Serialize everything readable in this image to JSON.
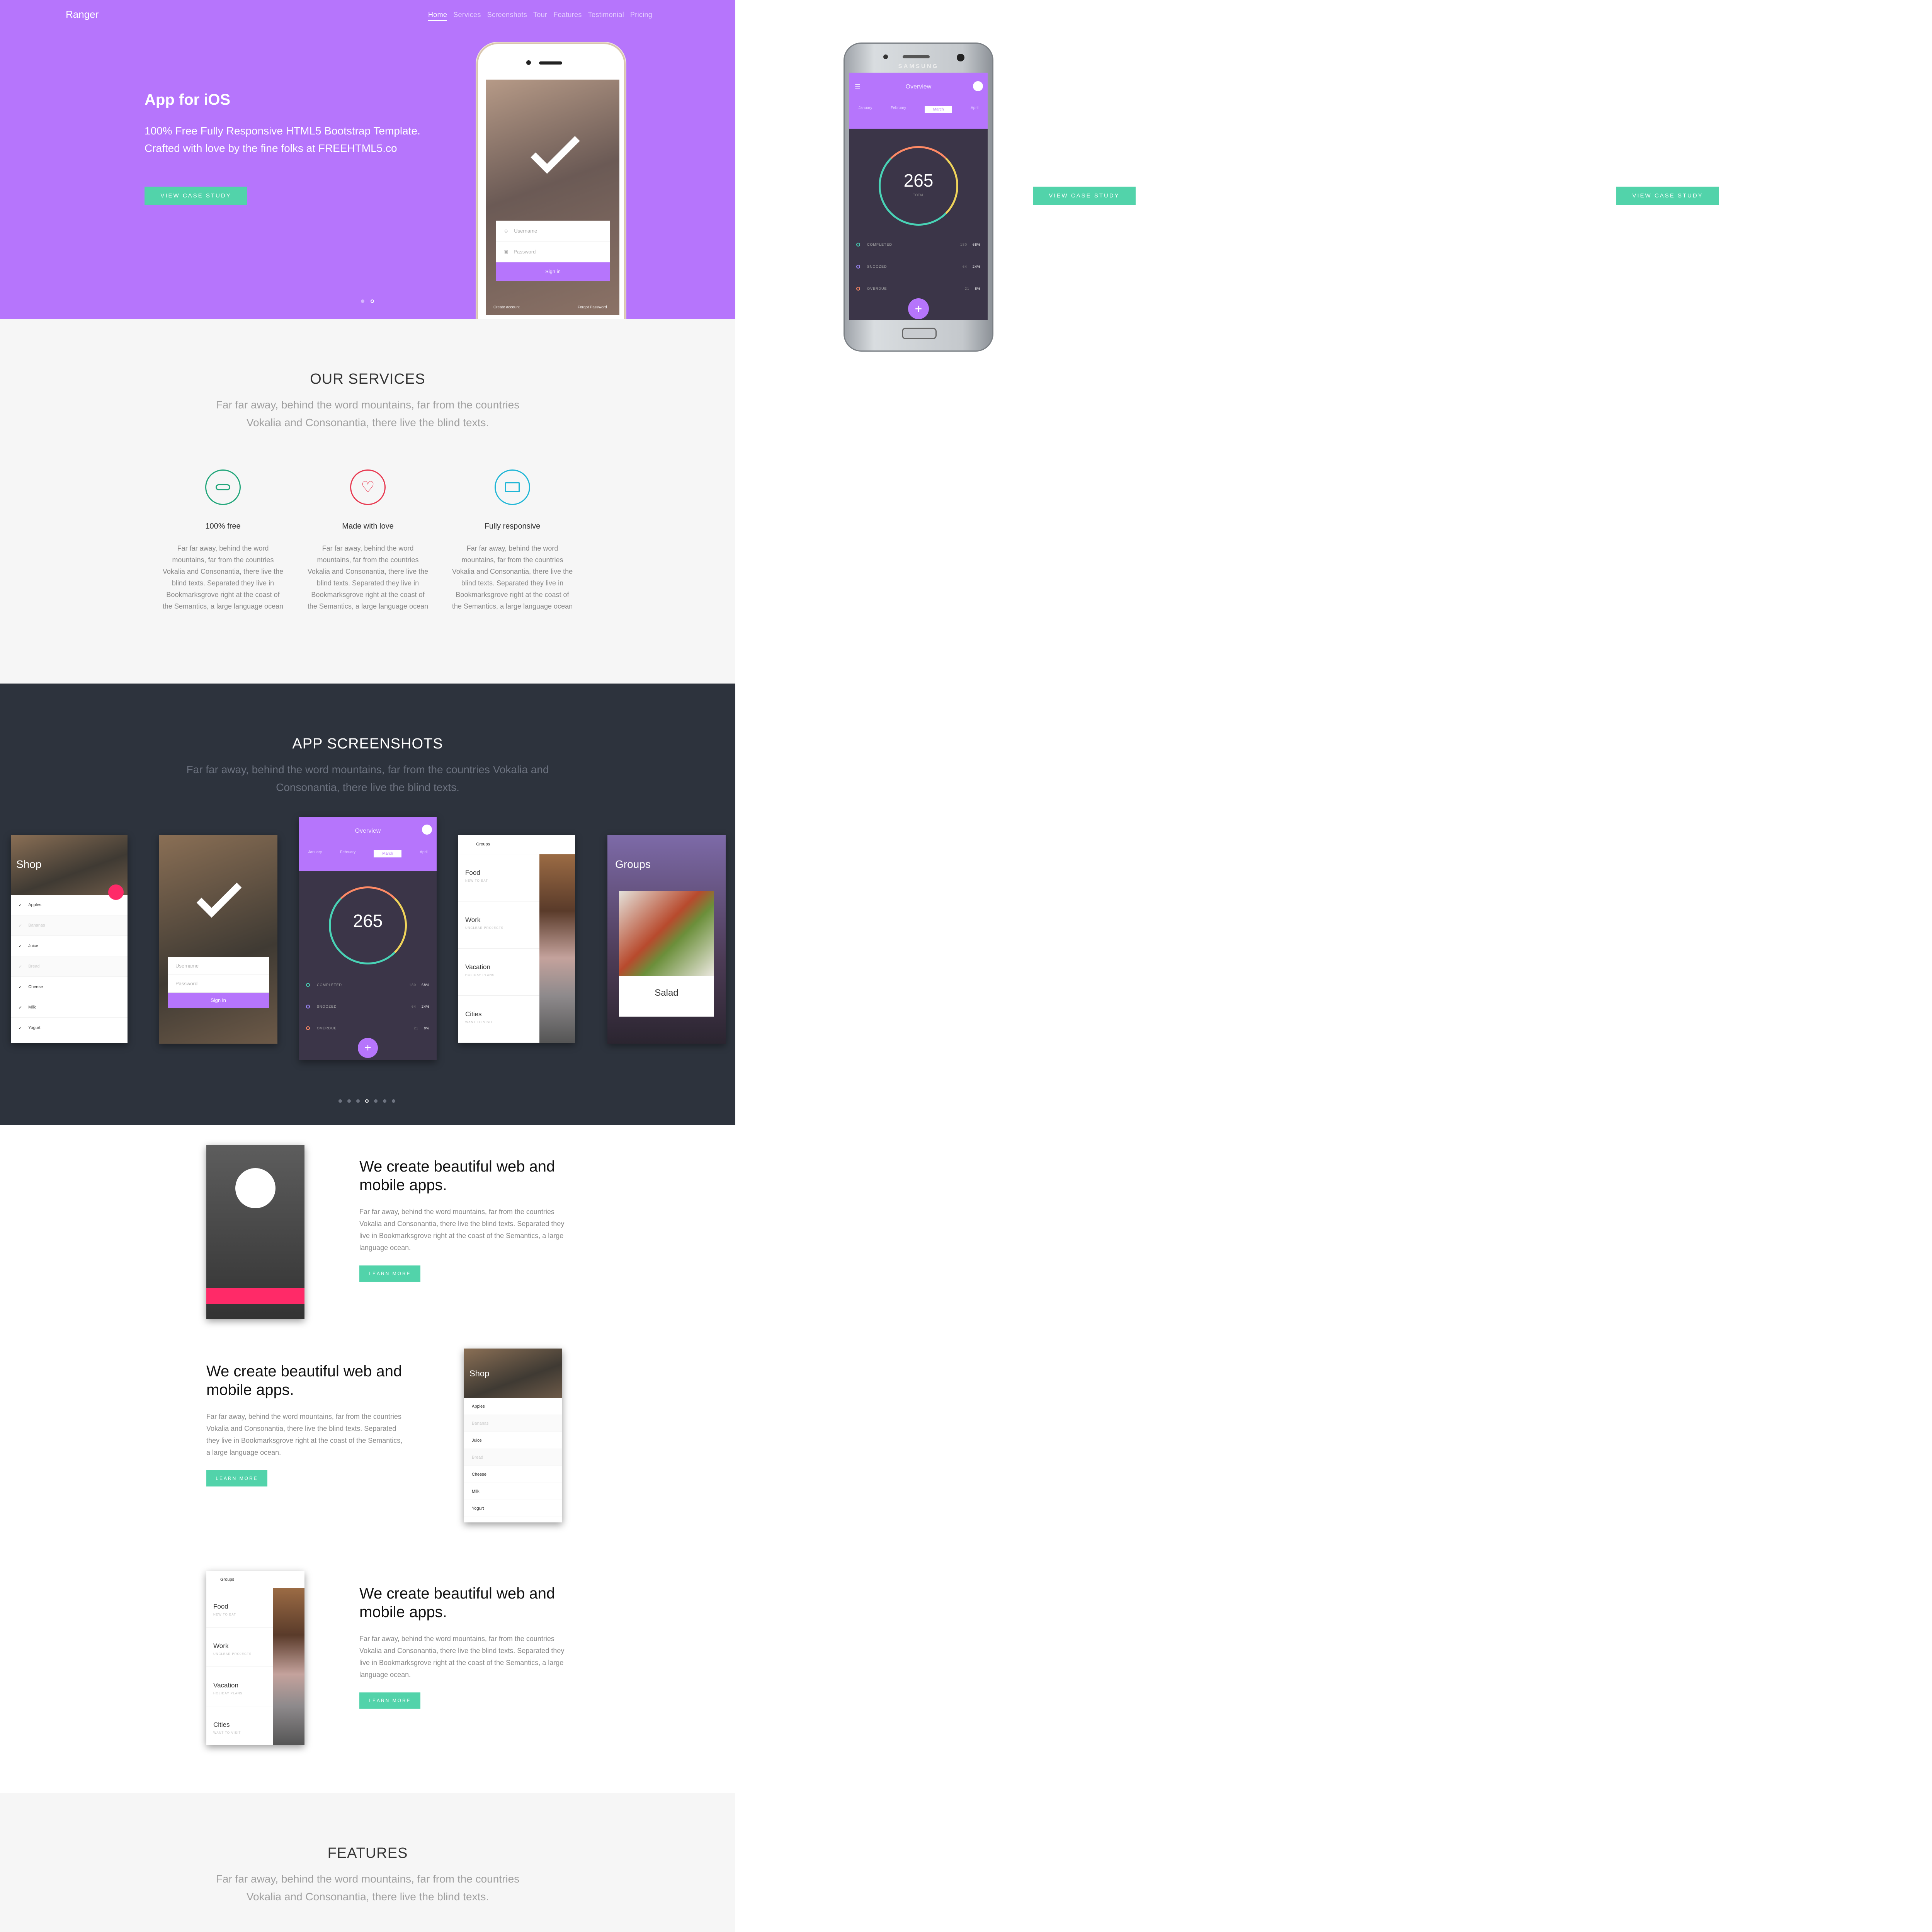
{
  "nav": {
    "brand": "Ranger",
    "items": [
      "Home",
      "Services",
      "Screenshots",
      "Tour",
      "Features",
      "Testimonial",
      "Pricing"
    ]
  },
  "hero": {
    "title": "App for iOS",
    "lead": "100% Free Fully Responsive HTML5 Bootstrap Template. Crafted with love by the fine folks at FREEHTML5.co",
    "cta": "VIEW CASE STUDY",
    "slide_count": 2,
    "active_slide": 2
  },
  "login_mock": {
    "username": "Username",
    "password": "Password",
    "signin": "Sign in",
    "create": "Create account",
    "forgot": "Forgot Password"
  },
  "overview_mock": {
    "title": "Overview",
    "months": [
      "January",
      "February",
      "March",
      "April"
    ],
    "active_month": "March",
    "total": "265",
    "total_label": "TOTAL",
    "stats": [
      {
        "label": "COMPLETED",
        "count": "180",
        "pct": "68%",
        "color": "#49d3b6"
      },
      {
        "label": "SNOOZED",
        "count": "64",
        "pct": "24%",
        "color": "#a08bff"
      },
      {
        "label": "OVERDUE",
        "count": "21",
        "pct": "8%",
        "color": "#ff8a65"
      }
    ],
    "brand": "SAMSUNG"
  },
  "extra_ctas": [
    "VIEW CASE STUDY",
    "VIEW CASE STUDY"
  ],
  "services": {
    "title": "OUR SERVICES",
    "subtitle": "Far far away, behind the word mountains, far from the countries Vokalia and Consonantia, there live the blind texts.",
    "items": [
      {
        "title": "100% free",
        "text": "Far far away, behind the word mountains, far from the countries Vokalia and Consonantia, there live the blind texts. Separated they live in Bookmarksgrove right at the coast of the Semantics, a large language ocean",
        "color": "#21a67a",
        "icon": "handshake-icon"
      },
      {
        "title": "Made with love",
        "text": "Far far away, behind the word mountains, far from the countries Vokalia and Consonantia, there live the blind texts. Separated they live in Bookmarksgrove right at the coast of the Semantics, a large language ocean",
        "color": "#e8384f",
        "icon": "heart-icon"
      },
      {
        "title": "Fully responsive",
        "text": "Far far away, behind the word mountains, far from the countries Vokalia and Consonantia, there live the blind texts. Separated they live in Bookmarksgrove right at the coast of the Semantics, a large language ocean",
        "color": "#1fb6d6",
        "icon": "monitor-icon"
      }
    ]
  },
  "screenshots": {
    "title": "APP SCREENSHOTS",
    "subtitle": "Far far away, behind the word mountains, far from the countries Vokalia and Consonantia, there live the blind texts.",
    "shop": {
      "title": "Shop",
      "items": [
        "Apples",
        "Bananas",
        "Juice",
        "Bread",
        "Cheese",
        "Milk",
        "Yogurt"
      ]
    },
    "groups": {
      "title": "Groups",
      "items": [
        {
          "name": "Food",
          "sub": "NEW TO EAT"
        },
        {
          "name": "Work",
          "sub": "UNCLEAR PROJECTS"
        },
        {
          "name": "Vacation",
          "sub": "HOLIDAY PLANS"
        },
        {
          "name": "Cities",
          "sub": "WANT TO VISIT"
        }
      ]
    },
    "salad": {
      "title": "Groups",
      "caption": "Salad"
    },
    "dot_count": 7,
    "active_dot": 4
  },
  "feature_rows": [
    {
      "title": "We create beautiful web and mobile apps.",
      "text": "Far far away, behind the word mountains, far from the countries Vokalia and Consonantia, there live the blind texts. Separated they live in Bookmarksgrove right at the coast of the Semantics, a large language ocean.",
      "cta": "LEARN MORE"
    },
    {
      "title": "We create beautiful web and mobile apps.",
      "text": "Far far away, behind the word mountains, far from the countries Vokalia and Consonantia, there live the blind texts. Separated they live in Bookmarksgrove right at the coast of the Semantics, a large language ocean.",
      "cta": "LEARN MORE"
    },
    {
      "title": "We create beautiful web and mobile apps.",
      "text": "Far far away, behind the word mountains, far from the countries Vokalia and Consonantia, there live the blind texts. Separated they live in Bookmarksgrove right at the coast of the Semantics, a large language ocean.",
      "cta": "LEARN MORE"
    }
  ],
  "features": {
    "title": "FEATURES",
    "subtitle": "Far far away, behind the word mountains, far from the countries Vokalia and Consonantia, there live the blind texts."
  },
  "colors": {
    "purple": "#b675fc",
    "green": "#52d3aa",
    "dark": "#2d333d",
    "pink": "#ff2a68"
  }
}
